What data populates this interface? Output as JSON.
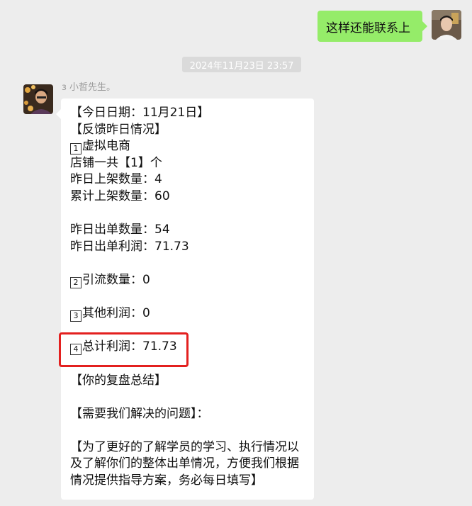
{
  "outgoing": {
    "text": "这样还能联系上"
  },
  "timestamp": "2024年11月23日 23:57",
  "incoming": {
    "sender": "ɜ 小哲先生。",
    "lines": {
      "date": "【今日日期：11月21日】",
      "feedback": "【反馈昨日情况】",
      "s1_num": "1",
      "s1_title": "虚拟电商",
      "shops": "店铺一共【1】个",
      "listed_yesterday": "昨日上架数量：4",
      "listed_total": "累计上架数量：60",
      "orders_yesterday": "昨日出单数量：54",
      "profit_yesterday": "昨日出单利润：71.73",
      "s2_num": "2",
      "s2_title": "引流数量：0",
      "s3_num": "3",
      "s3_title": "其他利润：0",
      "s4_num": "4",
      "s4_title": "总计利润：71.73",
      "review": "【你的复盘总结】",
      "problems": "【需要我们解决的问题】：",
      "note": "【为了更好的了解学员的学习、执行情况以及了解你们的整体出单情况，方便我们根据情况提供指导方案，务必每日填写】"
    }
  },
  "colors": {
    "background": "#ededed",
    "outgoing_bubble": "#95ec69",
    "incoming_bubble": "#ffffff",
    "highlight": "#e3201f"
  }
}
